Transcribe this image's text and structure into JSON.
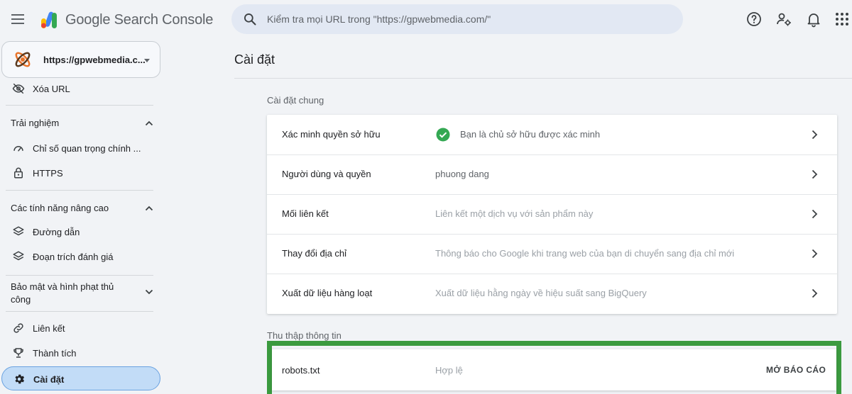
{
  "app": {
    "brand": "Google Search Console"
  },
  "search": {
    "placeholder": "Kiểm tra mọi URL trong \"https://gpwebmedia.com/\""
  },
  "topbar_icons": [
    "help-icon",
    "manage-users-icon",
    "notifications-icon",
    "apps-grid-icon"
  ],
  "property": {
    "name": "https://gpwebmedia.c..."
  },
  "sidebar": {
    "top_item": {
      "label": "Xóa URL",
      "icon": "eye-off-icon"
    },
    "sections": [
      {
        "title": "Trải nghiệm",
        "expanded": true,
        "items": [
          {
            "label": "Chỉ số quan trọng chính ...",
            "icon": "gauge-icon"
          },
          {
            "label": "HTTPS",
            "icon": "lock-icon"
          }
        ]
      },
      {
        "title": "Các tính năng nâng cao",
        "expanded": true,
        "items": [
          {
            "label": "Đường dẫn",
            "icon": "layers-icon"
          },
          {
            "label": "Đoạn trích đánh giá",
            "icon": "layers-icon"
          }
        ]
      },
      {
        "title": "Bảo mật và hình phạt thủ công",
        "expanded": false,
        "items": []
      }
    ],
    "bottom_items": [
      {
        "label": "Liên kết",
        "icon": "link-icon"
      },
      {
        "label": "Thành tích",
        "icon": "trophy-icon"
      },
      {
        "label": "Cài đặt",
        "icon": "gear-icon",
        "active": true
      }
    ]
  },
  "main": {
    "title": "Cài đặt",
    "general_label": "Cài đặt chung",
    "general_rows": [
      {
        "name": "Xác minh quyền sở hữu",
        "value": "Bạn là chủ sở hữu được xác minh",
        "verified": true
      },
      {
        "name": "Người dùng và quyền",
        "value": "phuong dang"
      },
      {
        "name": "Mối liên kết",
        "value": "Liên kết một dịch vụ với sản phẩm này"
      },
      {
        "name": "Thay đổi địa chỉ",
        "value": "Thông báo cho Google khi trang web của bạn di chuyển sang địa chỉ mới"
      },
      {
        "name": "Xuất dữ liệu hàng loạt",
        "value": "Xuất dữ liệu hằng ngày về hiệu suất sang BigQuery"
      }
    ],
    "crawl_label": "Thu thập thông tin",
    "crawl_rows": [
      {
        "name": "robots.txt",
        "value": "Hợp lệ",
        "action": "MỞ BÁO CÁO"
      }
    ]
  },
  "colors": {
    "background": "#f1f3f6",
    "active_nav": "#c2dcf7",
    "verified_green": "#34a853",
    "highlight_green": "#3b9a3f"
  }
}
